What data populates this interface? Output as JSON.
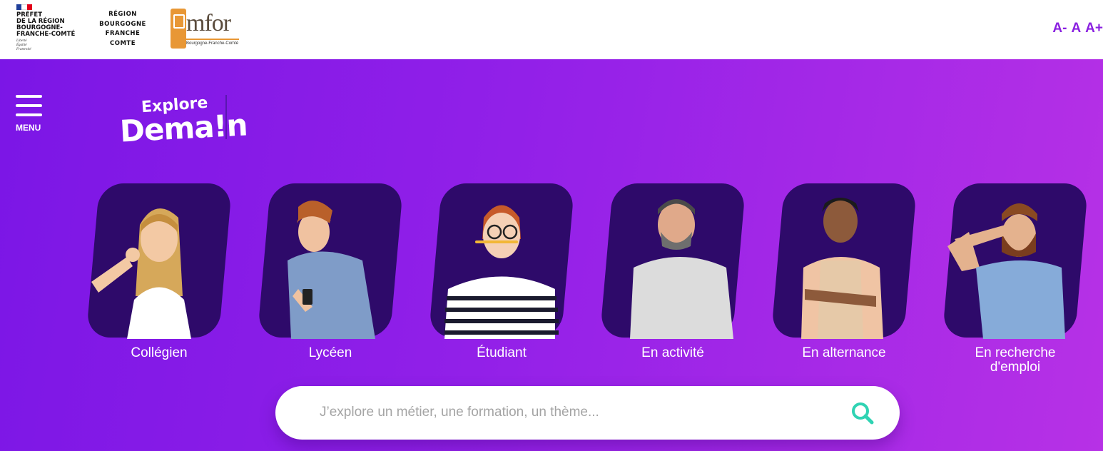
{
  "header": {
    "prefet": {
      "name": "PRÉFET\nDE LA RÉGION\nBOURGOGNE-\nFRANCHE-COMTÉ",
      "motto": "Liberté\nÉgalité\nFraternité"
    },
    "region": {
      "name": "RÉGION\nBOURGOGNE\nFRANCHE\nCOMTE"
    },
    "emfor": {
      "word": "mfor",
      "subtitle": "Bourgogne-Franche-Comté"
    },
    "font_size_controls": {
      "decrease": "A-",
      "normal": "A",
      "increase": "A+"
    }
  },
  "hero": {
    "menu_label": "MENU",
    "brand": {
      "line1": "Explore",
      "line2": "Dema!n"
    },
    "profiles": [
      {
        "label": "Collégien",
        "icon": "collegien-photo"
      },
      {
        "label": "Lycéen",
        "icon": "lyceen-photo"
      },
      {
        "label": "Étudiant",
        "icon": "etudiant-photo"
      },
      {
        "label": "En activité",
        "icon": "en-activite-photo"
      },
      {
        "label": "En alternance",
        "icon": "en-alternance-photo"
      },
      {
        "label": "En recherche\nd'emploi",
        "icon": "en-recherche-emploi-photo"
      }
    ],
    "search": {
      "placeholder": "J’explore un métier, une formation, un thème...",
      "value": ""
    }
  },
  "colors": {
    "brand_purple": "#8a20e0",
    "card_bg": "#2e0a6a",
    "search_icon": "#2fd3b3",
    "hero_gradient_start": "#7b16e6",
    "hero_gradient_end": "#b731e6"
  }
}
